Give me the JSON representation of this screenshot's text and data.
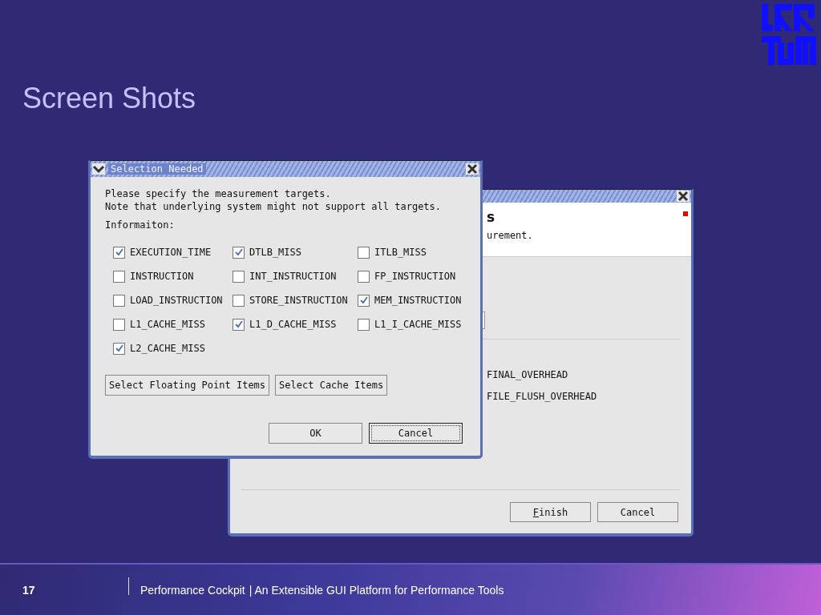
{
  "slide": {
    "title": "Screen Shots",
    "number": "17",
    "footer_title": "Performance Cockpit",
    "footer_subtitle": "| An Extensible GUI Platform for Performance Tools"
  },
  "back_window": {
    "heading": "s",
    "subtitle": "urement.",
    "items": [
      "FINAL_OVERHEAD",
      "FILE_FLUSH_OVERHEAD"
    ],
    "buttons": [
      {
        "label": "Finish",
        "underline_first": true
      },
      {
        "label": "Cancel",
        "underline_first": false
      }
    ]
  },
  "dialog": {
    "title": "Selection Needed",
    "lines": [
      "Please specify the measurement targets.",
      "Note that underlying system might not support all targets."
    ],
    "group_label": "Informaiton:",
    "targets": [
      {
        "label": "EXECUTION_TIME",
        "checked": true
      },
      {
        "label": "DTLB_MISS",
        "checked": true
      },
      {
        "label": "ITLB_MISS",
        "checked": false
      },
      {
        "label": "INSTRUCTION",
        "checked": false
      },
      {
        "label": "INT_INSTRUCTION",
        "checked": false
      },
      {
        "label": "FP_INSTRUCTION",
        "checked": false
      },
      {
        "label": "LOAD_INSTRUCTION",
        "checked": false
      },
      {
        "label": "STORE_INSTRUCTION",
        "checked": false
      },
      {
        "label": "MEM_INSTRUCTION",
        "checked": true
      },
      {
        "label": "L1_CACHE_MISS",
        "checked": false
      },
      {
        "label": "L1_D_CACHE_MISS",
        "checked": true
      },
      {
        "label": "L1_I_CACHE_MISS",
        "checked": false
      },
      {
        "label": "L2_CACHE_MISS",
        "checked": true
      }
    ],
    "select_buttons": [
      "Select Floating Point Items",
      "Select Cache Items"
    ],
    "buttons": [
      {
        "label": "OK",
        "focused": false
      },
      {
        "label": "Cancel",
        "focused": true
      }
    ]
  }
}
